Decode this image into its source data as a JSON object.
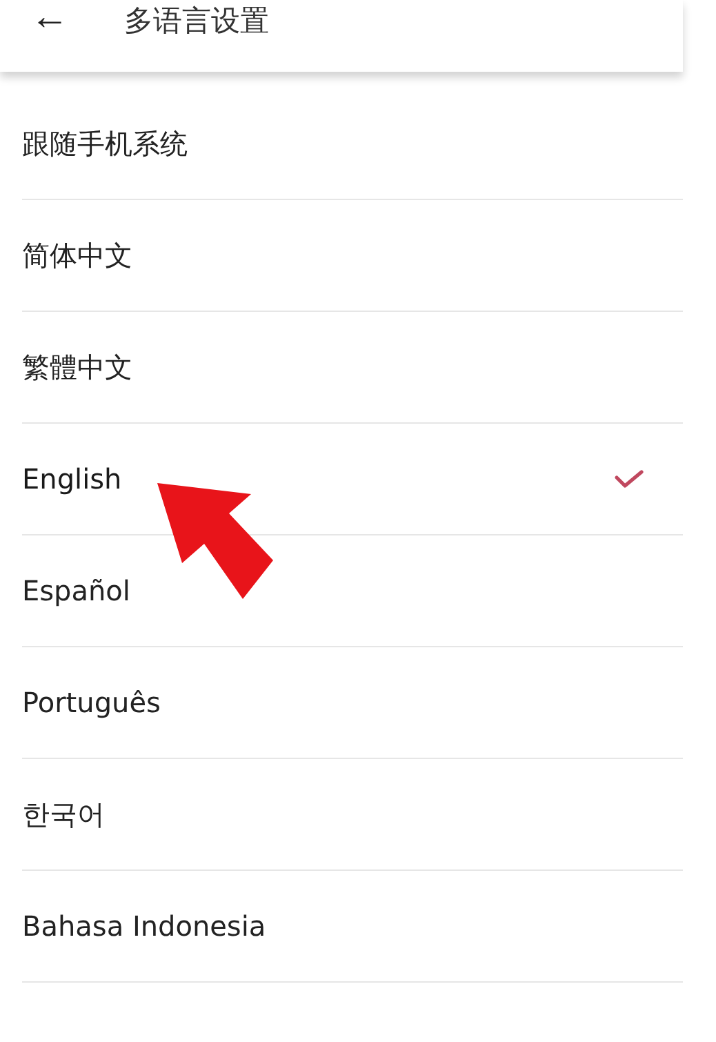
{
  "header": {
    "back_icon": "←",
    "title": "多语言设置"
  },
  "languages": [
    {
      "label": "跟随手机系统",
      "selected": false
    },
    {
      "label": "简体中文",
      "selected": false
    },
    {
      "label": "繁體中文",
      "selected": false
    },
    {
      "label": "English",
      "selected": true
    },
    {
      "label": "Español",
      "selected": false
    },
    {
      "label": "Português",
      "selected": false
    },
    {
      "label": "한국어",
      "selected": false
    },
    {
      "label": "Bahasa Indonesia",
      "selected": false
    }
  ]
}
